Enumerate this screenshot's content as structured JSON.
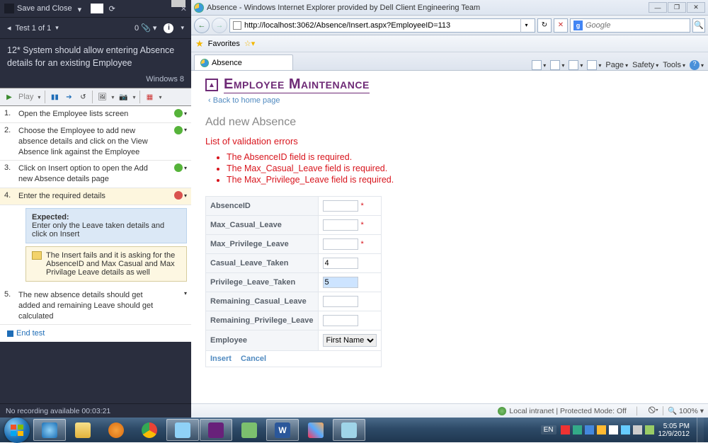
{
  "left": {
    "save_label": "Save and Close",
    "test_counter": "Test 1 of 1",
    "attachments": "0",
    "title": "12* System should allow entering Absence details for an existing Employee",
    "os": "Windows 8",
    "play": "Play",
    "steps": [
      {
        "n": "1.",
        "text": "Open the Employee lists screen",
        "pass": true
      },
      {
        "n": "2.",
        "text": "Choose the Employee to add new absence details and click on the View Absence link against the Employee",
        "pass": true
      },
      {
        "n": "3.",
        "text": "Click on Insert option to open the Add new Absence details page",
        "pass": true
      },
      {
        "n": "4.",
        "text": "Enter the required details",
        "fail": true
      },
      {
        "n": "5.",
        "text": "The new absence details should get added and remaining Leave should get calculated"
      }
    ],
    "expected_head": "Expected:",
    "expected_text": "Enter only the Leave taken details and click on Insert",
    "actual_text": "The Insert fails and it is asking for the AbsenceID and Max Casual and Max Privilage Leave details as well",
    "end_test": "End test",
    "status": "No recording available  00:03:21"
  },
  "ie": {
    "title": "Absence - Windows Internet Explorer provided by Dell Client Engineering Team",
    "url": "http://localhost:3062/Absence/Insert.aspx?EmployeeID=113",
    "search_placeholder": "Google",
    "favorites": "Favorites",
    "tab": "Absence",
    "cmd": {
      "page": "Page",
      "safety": "Safety",
      "tools": "Tools"
    },
    "zone": "Local intranet | Protected Mode: Off",
    "zoom": "100%"
  },
  "page": {
    "heading": "Employee Maintenance",
    "back": "Back to home page",
    "sub": "Add new Absence",
    "errhead": "List of validation errors",
    "errors": [
      "The AbsenceID field is required.",
      "The Max_Casual_Leave field is required.",
      "The Max_Privilege_Leave field is required."
    ],
    "fields": {
      "absence": "AbsenceID",
      "mcl": "Max_Casual_Leave",
      "mpl": "Max_Privilege_Leave",
      "clt": "Casual_Leave_Taken",
      "plt": "Privilege_Leave_Taken",
      "rcl": "Remaining_Casual_Leave",
      "rpl": "Remaining_Privilege_Leave",
      "emp": "Employee"
    },
    "values": {
      "clt": "4",
      "plt": "5",
      "emp_opt": "First Name"
    },
    "insert": "Insert",
    "cancel": "Cancel"
  },
  "tb": {
    "lang": "EN",
    "time": "5:05 PM",
    "date": "12/9/2012"
  }
}
